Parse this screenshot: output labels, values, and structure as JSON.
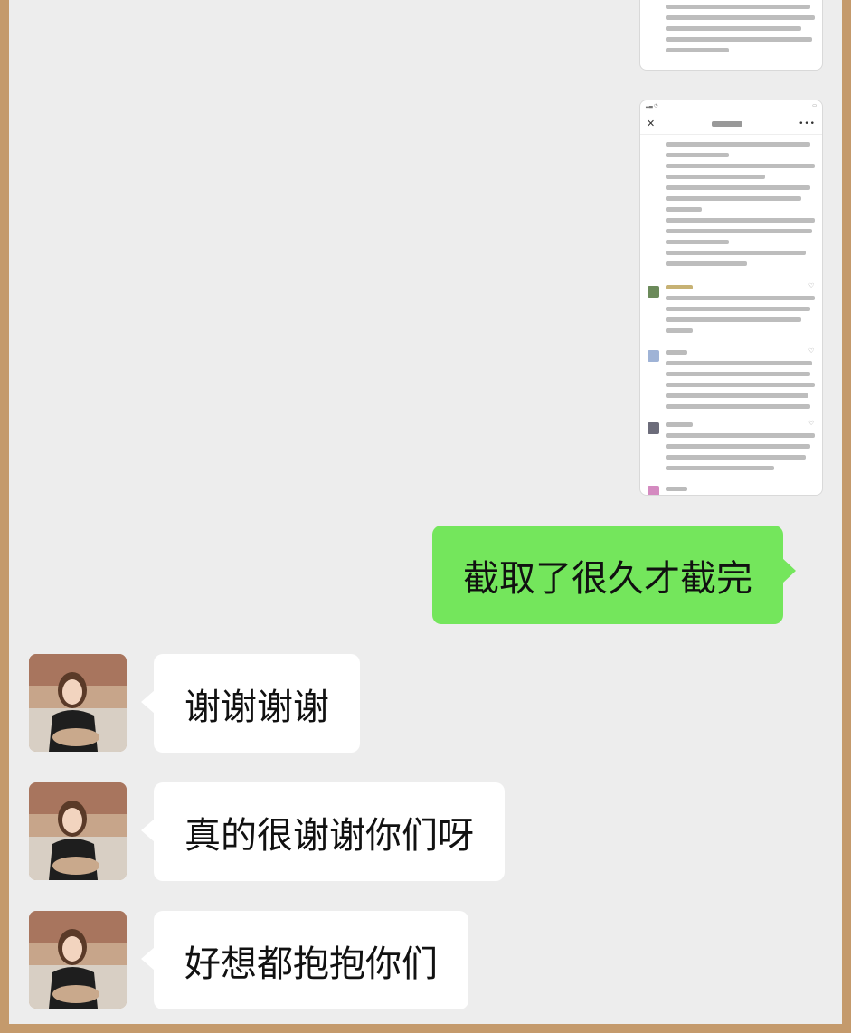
{
  "colors": {
    "frame_border": "#c49a6c",
    "chat_background": "#ededed",
    "my_bubble": "#74e65c",
    "their_bubble": "#ffffff"
  },
  "screenshot_thumbnail": {
    "nav_close_icon": "close-icon",
    "nav_more_icon": "more-icon"
  },
  "messages": [
    {
      "sender": "me",
      "text": "截取了很久才截完"
    },
    {
      "sender": "them",
      "text": "谢谢谢谢"
    },
    {
      "sender": "them",
      "text": "真的很谢谢你们呀"
    },
    {
      "sender": "them",
      "text": "好想都抱抱你们"
    }
  ]
}
